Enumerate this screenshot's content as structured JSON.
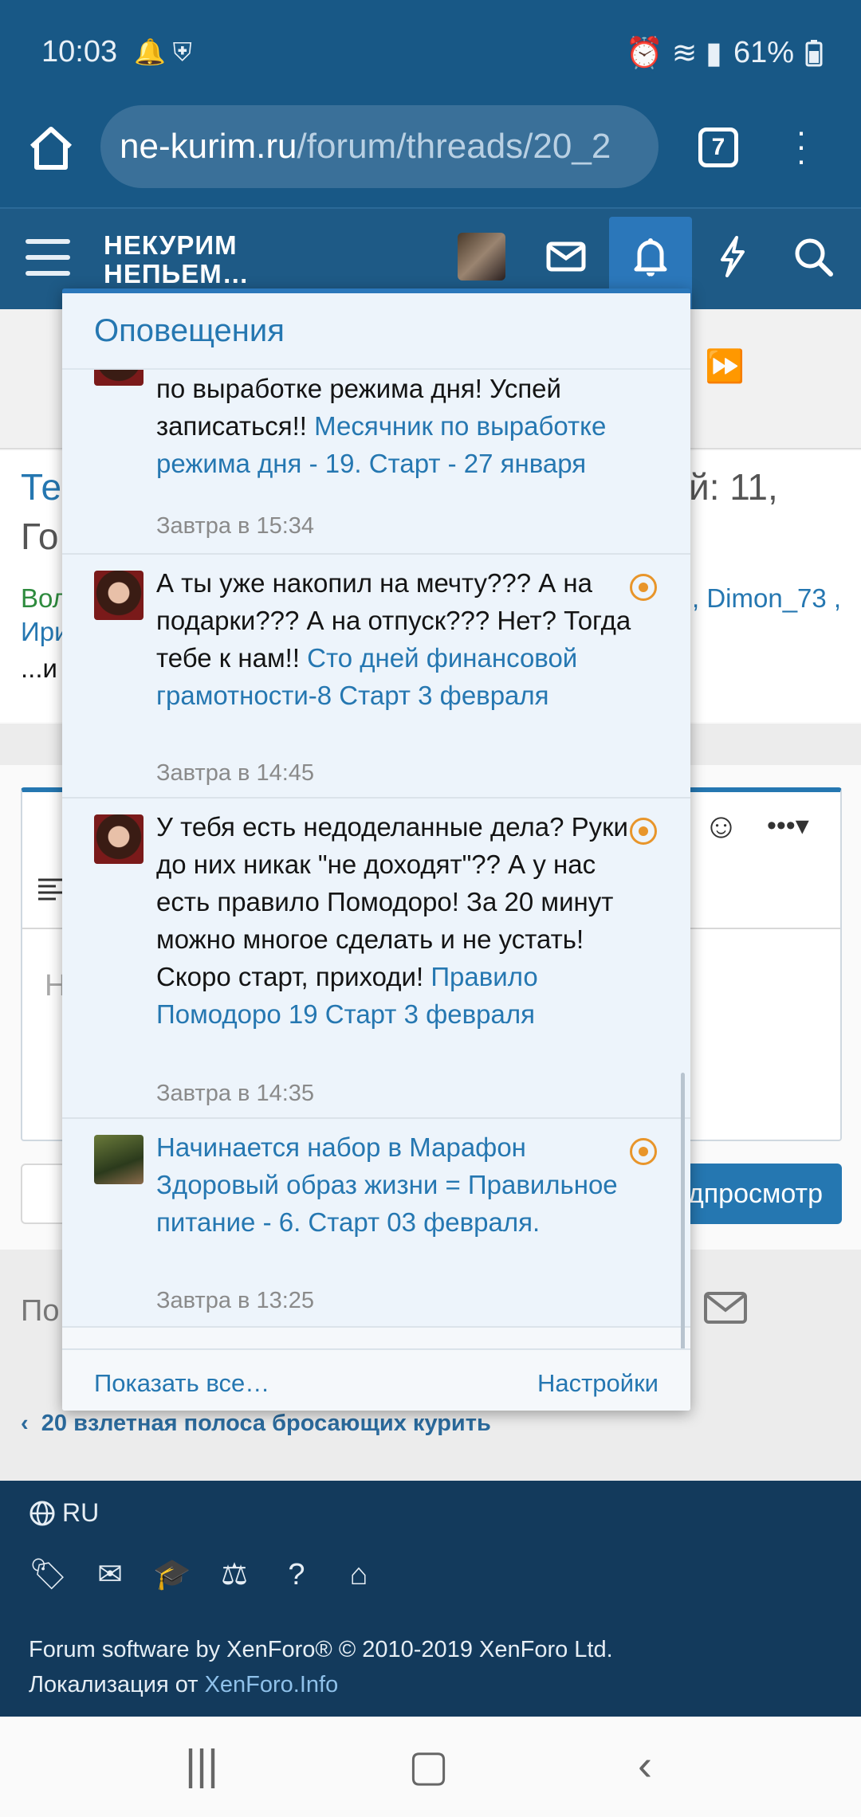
{
  "status_bar": {
    "time": "10:03",
    "battery": "61%",
    "left_icons": "🔔 ⛨",
    "right_icons": "⏰ ≋ ▮"
  },
  "browser": {
    "url_domain": "ne-kurim.ru",
    "url_path": "/forum/threads/20_2",
    "tab_count": "7"
  },
  "forum_nav": {
    "logo_line1": "НЕКУРИМ",
    "logo_line2": "НЕПЬЕМ…"
  },
  "background_page": {
    "title_part1": "Те",
    "title_part_right": "й: 11,",
    "title_part2": "Го",
    "users_part1": "Вол",
    "users_part_right": ", Dimon_73 ,",
    "users_part2": "Ири",
    "users_part3": "...и",
    "editor_placeholder": "Н",
    "preview_button": "дпросмотр",
    "share_label": "По",
    "breadcrumb": "20 взлетная полоса бросающих курить"
  },
  "popup": {
    "title": "Оповещения",
    "notifications": [
      {
        "text": "по выработке режима дня! Успей записаться!! ",
        "link": "Месячник по выработке режима дня - 19. Старт - 27 января",
        "time": "Завтра в 15:34"
      },
      {
        "text": "А ты уже накопил на мечту??? А на подарки??? А на отпуск??? Нет? Тогда тебе к нам!! ",
        "link": "Сто дней финансовой грамотности-8 Старт 3 февраля",
        "time": "Завтра в 14:45"
      },
      {
        "text": "У тебя есть недоделанные дела? Руки до них никак \"не доходят\"?? А у нас есть правило Помодоро! За 20 минут можно многое сделать и не устать! Скоро старт, приходи! ",
        "link": "Правило Помодоро 19 Старт 3 февраля",
        "time": "Завтра в 14:35"
      },
      {
        "text": "",
        "link": "Начинается набор в Марафон Здоровый образ жизни = Правильное питание - 6. Старт 03 февраля.",
        "time": "Завтра в 13:25"
      }
    ],
    "show_all": "Показать все…",
    "settings": "Настройки"
  },
  "footer": {
    "language": "RU",
    "copyright_line1": "Forum software by XenForo® © 2010-2019 XenForo Ltd.",
    "copyright_line2_text": "Локализация от ",
    "copyright_line2_link": "XenForo.Info"
  },
  "colors": {
    "header_blue": "#185886",
    "link_blue": "#2577b1",
    "unread_orange": "#e8952a",
    "footer_navy": "#133a5c"
  }
}
